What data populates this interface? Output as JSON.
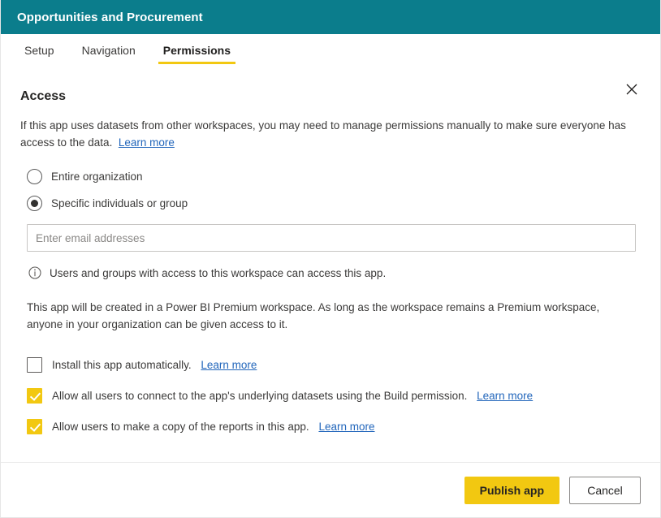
{
  "window": {
    "title": "Opportunities and Procurement",
    "header_color": "#0b7d8c",
    "close_icon": "close-icon"
  },
  "tabs": [
    {
      "label": "Setup",
      "active": false
    },
    {
      "label": "Navigation",
      "active": false
    },
    {
      "label": "Permissions",
      "active": true
    }
  ],
  "access": {
    "heading": "Access",
    "description": "If this app uses datasets from other workspaces, you may need to manage permissions manually to make sure everyone has access to the data.",
    "description_link": "Learn more",
    "radio_options": [
      {
        "label": "Entire organization",
        "selected": false
      },
      {
        "label": "Specific individuals or group",
        "selected": true
      }
    ],
    "email_field": {
      "placeholder": "Enter email addresses",
      "value": ""
    },
    "info_message": "Users and groups with access to this workspace can access this app.",
    "info_icon": "info-circle-icon",
    "premium_note": "This app will be created in a Power BI Premium workspace. As long as the workspace remains a Premium workspace, anyone in your organization can be given access to it."
  },
  "options": [
    {
      "label": "Install this app automatically.",
      "link": "Learn more",
      "checked": false,
      "name": "install-app-automatically"
    },
    {
      "label": "Allow all users to connect to the app's underlying datasets using the Build permission.",
      "link": "Learn more",
      "checked": true,
      "name": "allow-build-permission"
    },
    {
      "label": "Allow users to make a copy of the reports in this app.",
      "link": "Learn more",
      "checked": true,
      "name": "allow-copy-reports"
    }
  ],
  "footer": {
    "primary_label": "Publish app",
    "secondary_label": "Cancel",
    "primary_color": "#f2c811"
  }
}
